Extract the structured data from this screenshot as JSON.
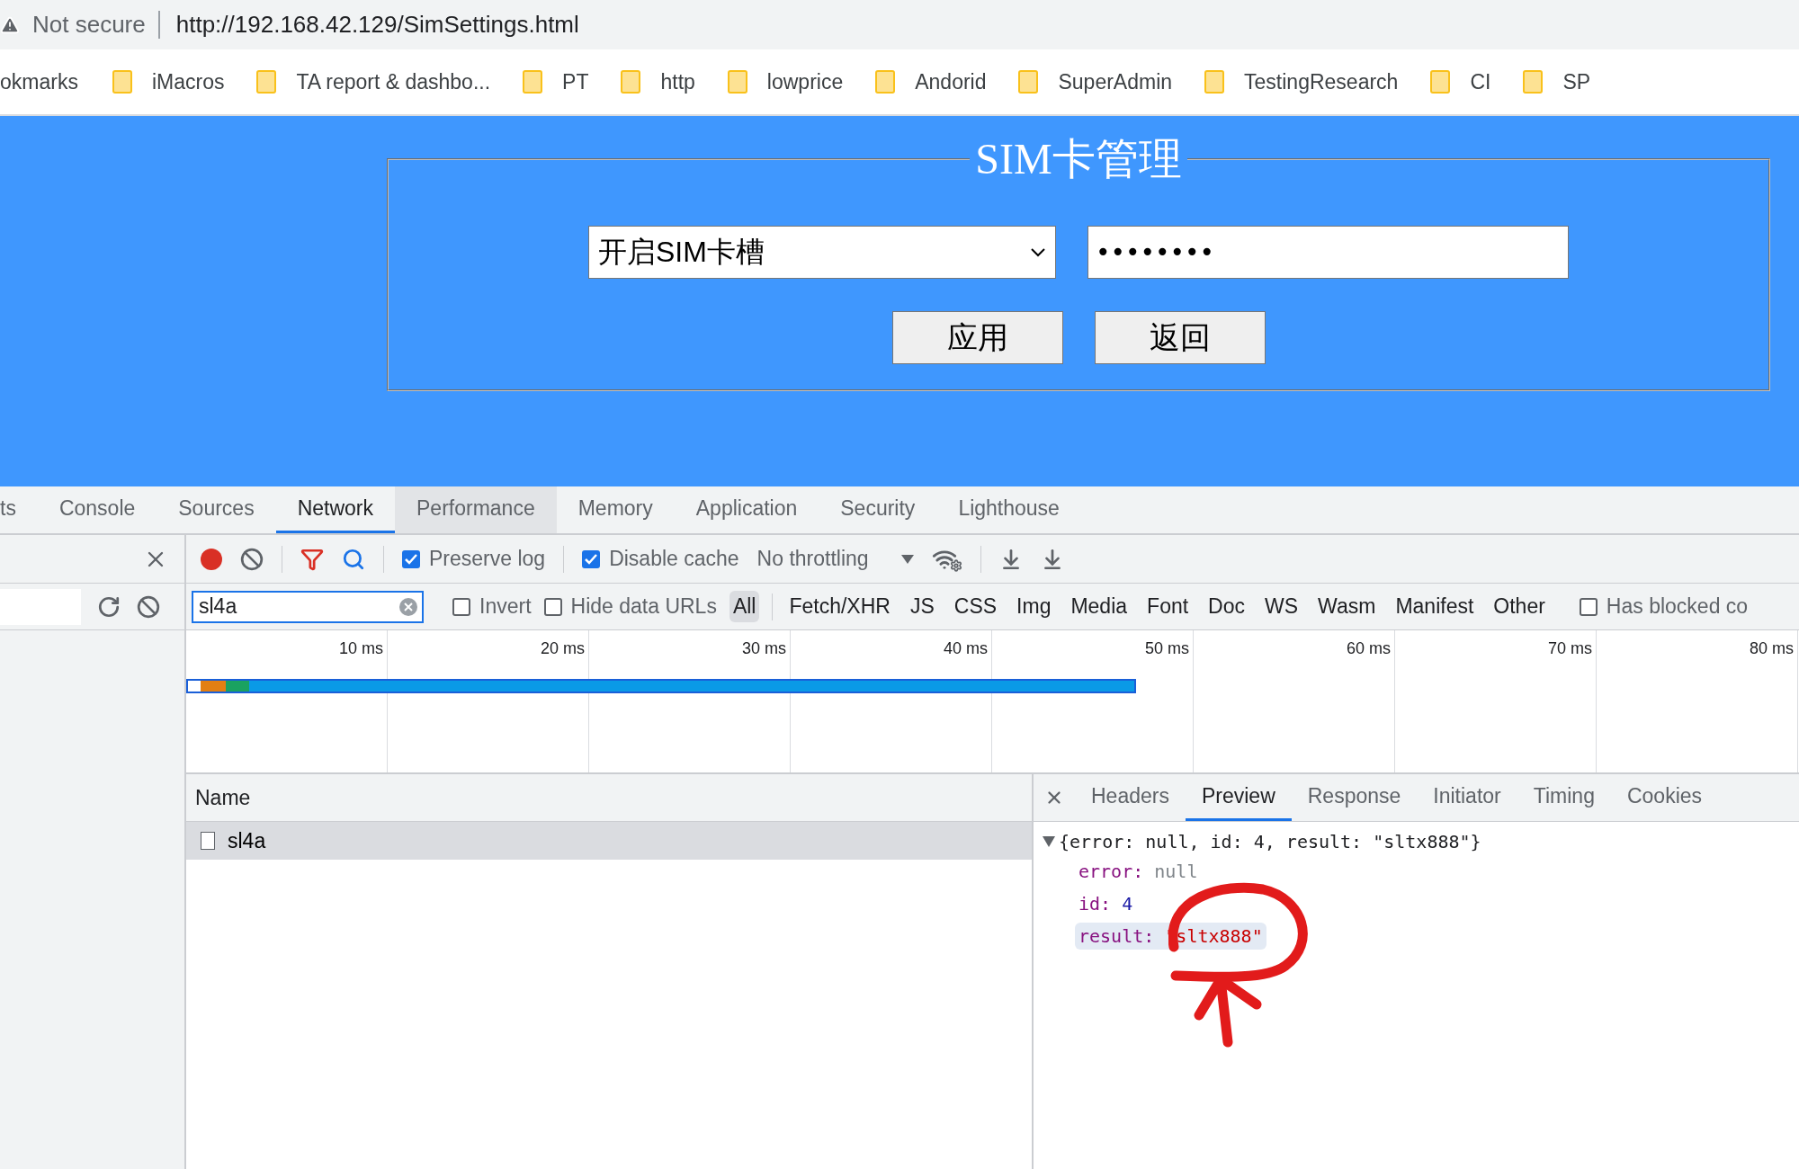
{
  "address_bar": {
    "security": "Not secure",
    "url": "http://192.168.42.129/SimSettings.html"
  },
  "bookmarks": [
    {
      "label": "okmarks",
      "kind": "text"
    },
    {
      "label": "iMacros",
      "kind": "folder"
    },
    {
      "label": "TA report & dashbo...",
      "kind": "folder"
    },
    {
      "label": "PT",
      "kind": "folder"
    },
    {
      "label": "http",
      "kind": "folder"
    },
    {
      "label": "lowprice",
      "kind": "folder"
    },
    {
      "label": "Andorid",
      "kind": "folder"
    },
    {
      "label": "SuperAdmin",
      "kind": "folder"
    },
    {
      "label": "TestingResearch",
      "kind": "folder"
    },
    {
      "label": "CI",
      "kind": "folder"
    },
    {
      "label": "SP",
      "kind": "folder"
    }
  ],
  "page": {
    "legend": "SIM卡管理",
    "select_value": "开启SIM卡槽",
    "password_value": "••••••••",
    "buttons": [
      "应用",
      "返回"
    ]
  },
  "devtools": {
    "tabs": [
      {
        "label": "ts",
        "selected": false,
        "highlighted": false
      },
      {
        "label": "Console",
        "selected": false,
        "highlighted": false
      },
      {
        "label": "Sources",
        "selected": false,
        "highlighted": false
      },
      {
        "label": "Network",
        "selected": true,
        "highlighted": false
      },
      {
        "label": "Performance",
        "selected": false,
        "highlighted": true
      },
      {
        "label": "Memory",
        "selected": false,
        "highlighted": false
      },
      {
        "label": "Application",
        "selected": false,
        "highlighted": false
      },
      {
        "label": "Security",
        "selected": false,
        "highlighted": false
      },
      {
        "label": "Lighthouse",
        "selected": false,
        "highlighted": false
      }
    ],
    "toolbar": {
      "recording": true,
      "preserve_log": {
        "label": "Preserve log",
        "checked": true
      },
      "disable_cache": {
        "label": "Disable cache",
        "checked": true
      },
      "throttling": "No throttling"
    },
    "filter": {
      "value": "sl4a",
      "invert": {
        "label": "Invert",
        "checked": false
      },
      "hide_data_urls": {
        "label": "Hide data URLs",
        "checked": false
      },
      "types": [
        {
          "label": "All",
          "selected": true
        },
        {
          "label": "Fetch/XHR",
          "selected": false
        },
        {
          "label": "JS",
          "selected": false
        },
        {
          "label": "CSS",
          "selected": false
        },
        {
          "label": "Img",
          "selected": false
        },
        {
          "label": "Media",
          "selected": false
        },
        {
          "label": "Font",
          "selected": false
        },
        {
          "label": "Doc",
          "selected": false
        },
        {
          "label": "WS",
          "selected": false
        },
        {
          "label": "Wasm",
          "selected": false
        },
        {
          "label": "Manifest",
          "selected": false
        },
        {
          "label": "Other",
          "selected": false
        }
      ],
      "has_blocked": {
        "label": "Has blocked co",
        "checked": false
      }
    },
    "timeline_ticks": [
      "10 ms",
      "20 ms",
      "30 ms",
      "40 ms",
      "50 ms",
      "60 ms",
      "70 ms",
      "80 ms"
    ],
    "name_header": "Name",
    "requests": [
      {
        "name": "sl4a",
        "selected": true
      }
    ],
    "detail_tabs": [
      {
        "label": "Headers",
        "selected": false
      },
      {
        "label": "Preview",
        "selected": true
      },
      {
        "label": "Response",
        "selected": false
      },
      {
        "label": "Initiator",
        "selected": false
      },
      {
        "label": "Timing",
        "selected": false
      },
      {
        "label": "Cookies",
        "selected": false
      }
    ],
    "preview": {
      "summary": "{error: null, id: 4, result: \"sltx888\"}",
      "expanded": true,
      "properties": [
        {
          "key": "error:",
          "value": "null",
          "kind": "null",
          "selected": false
        },
        {
          "key": "id:",
          "value": "4",
          "kind": "number",
          "selected": false
        },
        {
          "key": "result:",
          "value": "\"sltx888\"",
          "kind": "string",
          "selected": true
        }
      ]
    }
  }
}
